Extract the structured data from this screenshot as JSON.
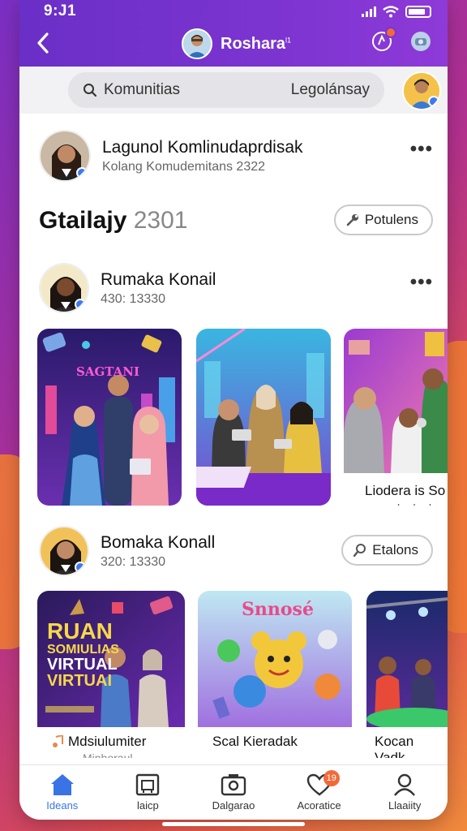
{
  "status": {
    "time": "9:J1"
  },
  "header": {
    "title": "Roshara",
    "title_sup": "l1"
  },
  "search": {
    "placeholder": "Komunitias",
    "tab_label": "Legolánsay"
  },
  "post1": {
    "name": "Lagunol Komlinudaprdisak",
    "subtitle": "Kolang Komudemitans 2322"
  },
  "section": {
    "title": "Gtailajy",
    "year": "2301",
    "pill_label": "Potulens"
  },
  "post2": {
    "name": "Rumaka Konail",
    "meta": "430: 13330"
  },
  "row1_cards": [
    {
      "sign_text": "SAGTANI"
    },
    {},
    {
      "caption": "Liodera is So",
      "subcaption": "korkad"
    }
  ],
  "post3": {
    "name": "Bomaka Konall",
    "meta": "320: 13330",
    "pill_label": "Etalons"
  },
  "row2_cards": [
    {
      "poster_lines": [
        "RUAN",
        "SOMIULIAS",
        "VIRTUAL",
        "VIRTUAI"
      ],
      "caption": "Mdsiulumiter",
      "subcaption": "Minhoraul"
    },
    {
      "poster_title": "Snnosé",
      "caption": "Scal Kieradak"
    },
    {
      "caption": "Kocan Vadk"
    }
  ],
  "tabs": [
    {
      "label": "Ideans",
      "icon": "home-icon",
      "active": true
    },
    {
      "label": "laicp",
      "icon": "gallery-icon"
    },
    {
      "label": "Dalgarao",
      "icon": "camera-icon"
    },
    {
      "label": "Acoratice",
      "icon": "heart-icon",
      "badge": "19"
    },
    {
      "label": "Llaaiity",
      "icon": "profile-icon"
    }
  ],
  "colors": {
    "accent": "#3a73e6",
    "header": "#7c34d0",
    "badge": "#f16a3a"
  }
}
